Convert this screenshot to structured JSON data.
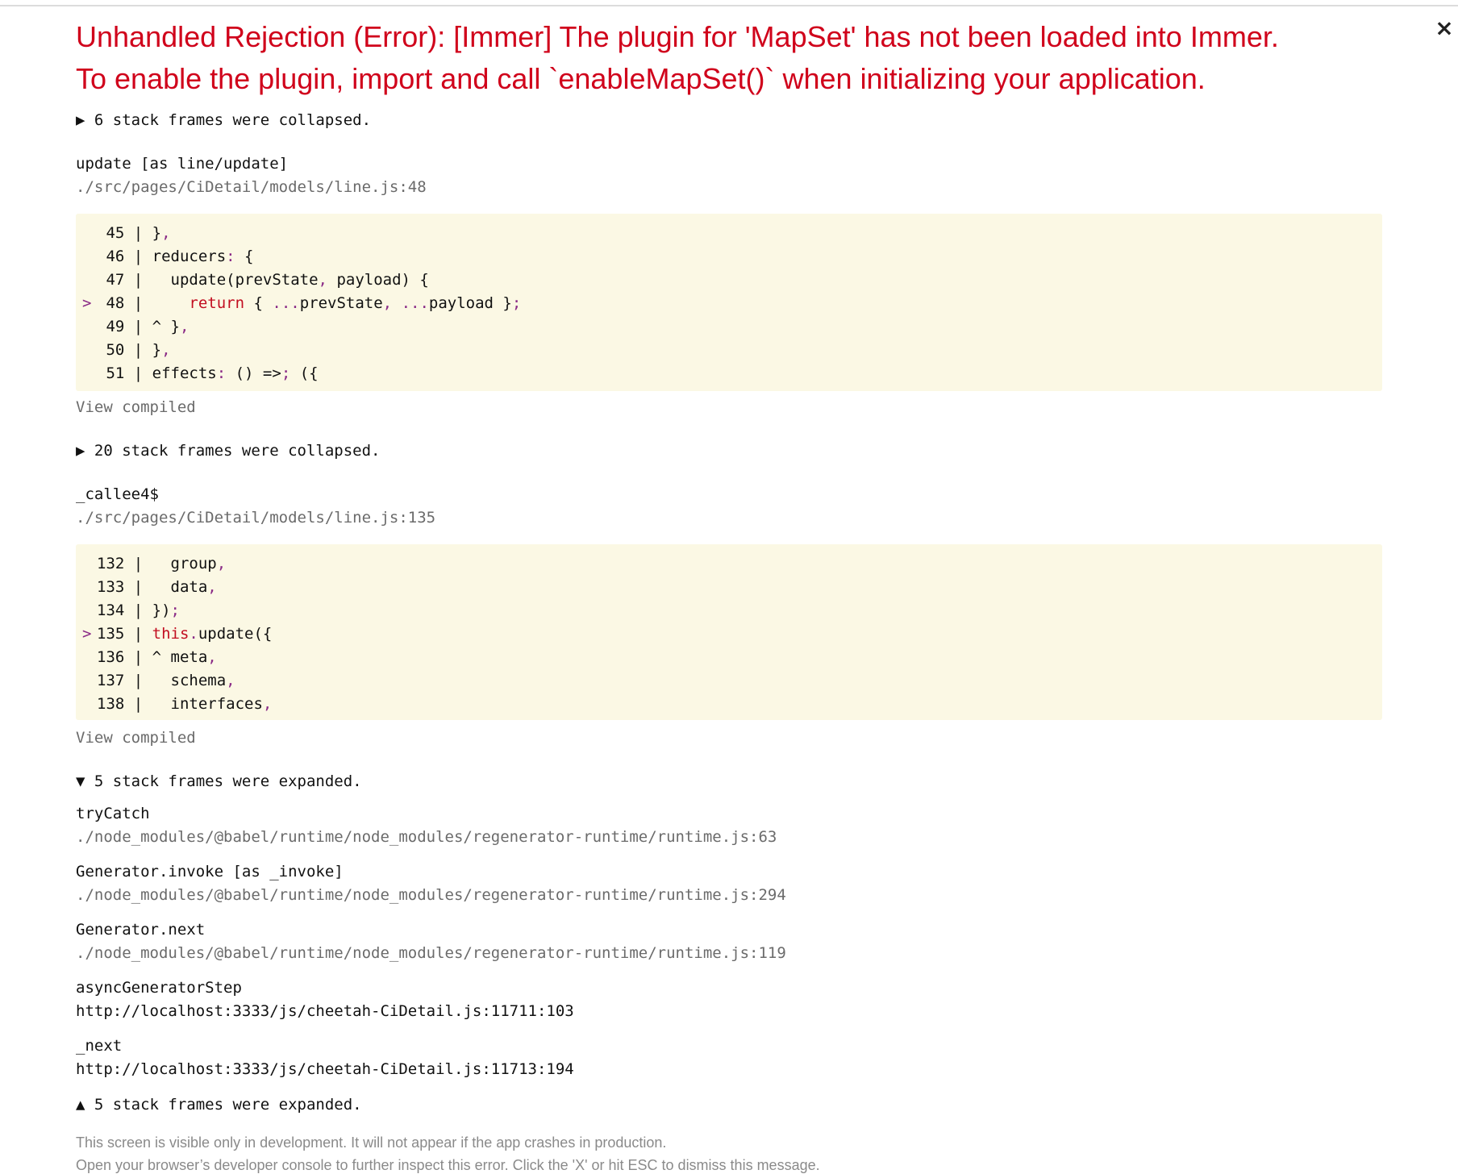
{
  "error": {
    "title_line1": "Unhandled Rejection (Error): [Immer] The plugin for 'MapSet' has not been loaded into Immer.",
    "title_line2": "To enable the plugin, import and call `enableMapSet()` when initializing your application.",
    "close_label": "×"
  },
  "toggles": {
    "first": "▶ 6 stack frames were collapsed.",
    "second": "▶ 20 stack frames were collapsed.",
    "expanded_top": "▼ 5 stack frames were expanded.",
    "expanded_bottom": "▲ 5 stack frames were expanded."
  },
  "frame1": {
    "fn": "update [as line/update]",
    "loc": "./src/pages/CiDetail/models/line.js:48",
    "view_compiled": "View compiled",
    "code": [
      {
        "num": "45",
        "mark": "",
        "text": "},"
      },
      {
        "num": "46",
        "mark": "",
        "text": "reducers: {"
      },
      {
        "num": "47",
        "mark": "",
        "text": "  update(prevState, payload) {"
      },
      {
        "num": "48",
        "mark": ">",
        "text": "    return { ...prevState, ...payload };"
      },
      {
        "num": "49",
        "mark": "",
        "text": "^ },"
      },
      {
        "num": "50",
        "mark": "",
        "text": "},"
      },
      {
        "num": "51",
        "mark": "",
        "text": "effects: () => ({"
      }
    ]
  },
  "frame2": {
    "fn": "_callee4$",
    "loc": "./src/pages/CiDetail/models/line.js:135",
    "view_compiled": "View compiled",
    "code": [
      {
        "num": "132",
        "mark": "",
        "text": "  group,"
      },
      {
        "num": "133",
        "mark": "",
        "text": "  data,"
      },
      {
        "num": "134",
        "mark": "",
        "text": "});"
      },
      {
        "num": "135",
        "mark": ">",
        "text": "this.update({"
      },
      {
        "num": "136",
        "mark": "",
        "text": "^ meta,"
      },
      {
        "num": "137",
        "mark": "",
        "text": "  schema,"
      },
      {
        "num": "138",
        "mark": "",
        "text": "  interfaces,"
      }
    ]
  },
  "expanded_frames": [
    {
      "fn": "tryCatch",
      "loc": "./node_modules/@babel/runtime/node_modules/regenerator-runtime/runtime.js:63"
    },
    {
      "fn": "Generator.invoke [as _invoke]",
      "loc": "./node_modules/@babel/runtime/node_modules/regenerator-runtime/runtime.js:294"
    },
    {
      "fn": "Generator.next",
      "loc": "./node_modules/@babel/runtime/node_modules/regenerator-runtime/runtime.js:119"
    },
    {
      "fn": "asyncGeneratorStep",
      "loc": "http://localhost:3333/js/cheetah-CiDetail.js:11711:103"
    },
    {
      "fn": "_next",
      "loc": "http://localhost:3333/js/cheetah-CiDetail.js:11713:194"
    }
  ],
  "footer": {
    "line1": "This screen is visible only in development. It will not appear if the app crashes in production.",
    "line2": "Open your browser’s developer console to further inspect this error.  Click the 'X' or hit ESC to dismiss this message."
  }
}
